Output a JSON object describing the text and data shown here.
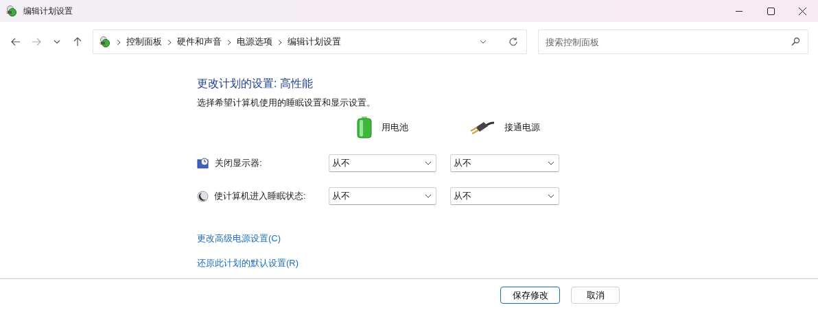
{
  "window": {
    "title": "编辑计划设置"
  },
  "navigation": [
    {
      "kind": "back",
      "disabled": false
    },
    {
      "kind": "forward",
      "disabled": true
    },
    {
      "kind": "recent",
      "disabled": false
    },
    {
      "kind": "up",
      "disabled": false
    }
  ],
  "address_bar": {
    "breadcrumbs": [
      "控制面板",
      "硬件和声音",
      "电源选项",
      "编辑计划设置"
    ]
  },
  "search": {
    "placeholder": "搜索控制面板"
  },
  "heading": "更改计划的设置: 高性能",
  "description": "选择希望计算机使用的睡眠设置和显示设置。",
  "columns": [
    {
      "kind": "battery",
      "label": "用电池"
    },
    {
      "kind": "plugged",
      "label": "接通电源"
    }
  ],
  "settings": [
    {
      "kind": "display",
      "label": "关闭显示器:",
      "values": [
        "从不",
        "从不"
      ]
    },
    {
      "kind": "sleep",
      "label": "使计算机进入睡眠状态:",
      "values": [
        "从不",
        "从不"
      ]
    }
  ],
  "links": [
    "更改高级电源设置(C)",
    "还原此计划的默认设置(R)"
  ],
  "buttons": [
    {
      "label": "保存修改",
      "default": true
    },
    {
      "label": "取消",
      "default": false
    }
  ]
}
